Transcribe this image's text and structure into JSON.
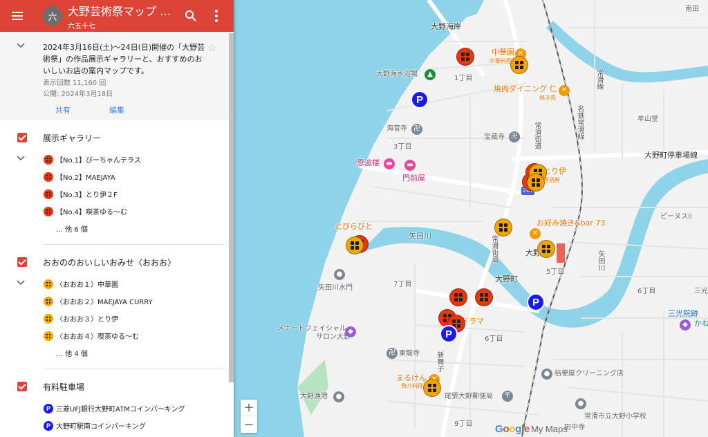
{
  "header": {
    "avatar": "六",
    "title": "大野芸術祭マップ OH...",
    "subtitle": "六五十七"
  },
  "description": {
    "text": "2024年3月16日(土)〜24日(日)開催の「大野芸術祭」の作品展示ギャラリーと、おすすめのおいしいお店の案内マップです。",
    "views": "表示回数 11,160 回",
    "published": "公開: 2024年3月18日",
    "share": "共有",
    "edit": "編集"
  },
  "layers": [
    {
      "title": "展示ギャラリー",
      "icon_color": "#e6380f",
      "items": [
        "【No.1】びーちゃんテラス",
        "【No.2】MAEJAYA",
        "【No.3】とり伊２F",
        "【No.4】喫茶ゆる〜む"
      ],
      "more": "… 他 6 個"
    },
    {
      "title": "おおののおいしいおみせ〈おおお〉",
      "icon_color": "#f0a500",
      "items": [
        "〈おおお１〉中華園",
        "〈おおお２〉MAEJAYA CURRY",
        "〈おおお３〉とり伊",
        "〈おおお４〉喫茶ゆる〜む"
      ],
      "more": "… 他 4 個"
    },
    {
      "title": "有料駐車場",
      "icon_color": "#1a1aef",
      "items": [
        "三菱UFJ銀行大野町ATMコインパーキング",
        "大野町駅南コインパーキング"
      ]
    }
  ],
  "map_labels": {
    "ono_kaigan": "大野海岸",
    "ono_kaisuiyokujo": "大野海水浴場",
    "chukaen": "中華園",
    "chukaen_sub": "中華料理",
    "chome1": "1丁目",
    "yakiniku": "焼肉ダイニング 仁",
    "yakiniku_sub": "焼き肉",
    "kaionji": "海音寺",
    "hozoji": "宝蔵寺",
    "chome3": "3丁目",
    "onhaku": "恩波楼",
    "monzenya": "門前屋",
    "torii": "とり伊",
    "torii_sub": "居酒屋",
    "tobirabito": "とびらびと",
    "yatagawa": "矢田川",
    "okonomiyaki": "お好み焼き&bar 73",
    "ono": "大野",
    "onomachi": "大野町",
    "chome5": "5丁目",
    "chome7": "7丁目",
    "yatagawa_suimon": "矢田川水門",
    "menard": "メナードフェイシャル\nサロン大野",
    "drama": "ドラマ",
    "chome6": "6丁目",
    "toryuji": "東龍寺",
    "maruken": "まるけん",
    "maruken_sub": "魚介料理",
    "kikyoya": "桔梗屋クリーニング店",
    "ono_gyoko": "大野漁港",
    "owari_ono_post": "尾張大野郵便局",
    "tokoname_shiritsu": "常滑市立大野小学校",
    "chome9": "9丁目",
    "tanaka": "田中寺",
    "nanden": "南田",
    "museyama": "牟山堂",
    "onomachi_parking": "大野町停車場線",
    "pinus": "ピーヌスII",
    "yatagawa_east": "矢田川",
    "chome6e": "6丁目",
    "sanko": "三光",
    "sanko_inseki": "三光院跡",
    "kane": "かね",
    "mei_tetsu": "名鉄常滑線",
    "tokoname_kaido": "常滑街道",
    "shinmaiko": "新舞子",
    "route": "267",
    "tokoname_kaido_2": "常滑街道"
  },
  "google_logo": "Google",
  "my_maps": "My Maps",
  "zoom_in": "+",
  "zoom_out": "−",
  "colors": {
    "header": "#db4437",
    "water": "#8fd3e8",
    "land": "#efefef",
    "gallery_marker": "#e6380f",
    "restaurant_marker": "#f0a500",
    "parking_marker": "#1a1aef"
  }
}
